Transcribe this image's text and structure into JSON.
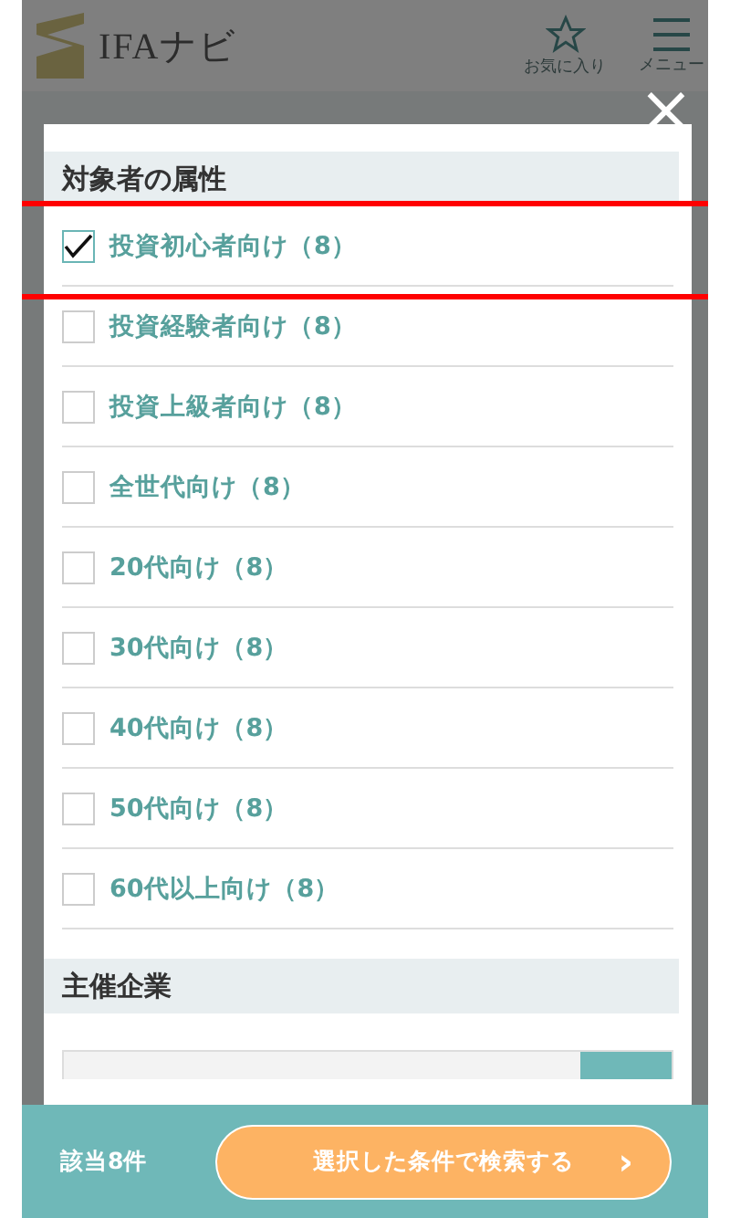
{
  "header": {
    "logo_text": "IFAナビ",
    "favorites": {
      "label": "お気に入り"
    },
    "menu": {
      "label": "メニュー"
    }
  },
  "modal": {
    "close": "×",
    "sections": [
      {
        "title": "対象者の属性",
        "options": [
          {
            "label": "投資初心者向け（8）",
            "checked": true,
            "highlighted": true
          },
          {
            "label": "投資経験者向け（8）",
            "checked": false,
            "highlighted": false
          },
          {
            "label": "投資上級者向け（8）",
            "checked": false,
            "highlighted": false
          },
          {
            "label": "全世代向け（8）",
            "checked": false,
            "highlighted": false
          },
          {
            "label": "20代向け（8）",
            "checked": false,
            "highlighted": false
          },
          {
            "label": "30代向け（8）",
            "checked": false,
            "highlighted": false
          },
          {
            "label": "40代向け（8）",
            "checked": false,
            "highlighted": false
          },
          {
            "label": "50代向け（8）",
            "checked": false,
            "highlighted": false
          },
          {
            "label": "60代以上向け（8）",
            "checked": false,
            "highlighted": false
          }
        ]
      },
      {
        "title": "主催企業",
        "kind": "search"
      }
    ]
  },
  "footer": {
    "count": "該当8件",
    "search_button": "選択した条件で検索する",
    "chevron": "›"
  }
}
